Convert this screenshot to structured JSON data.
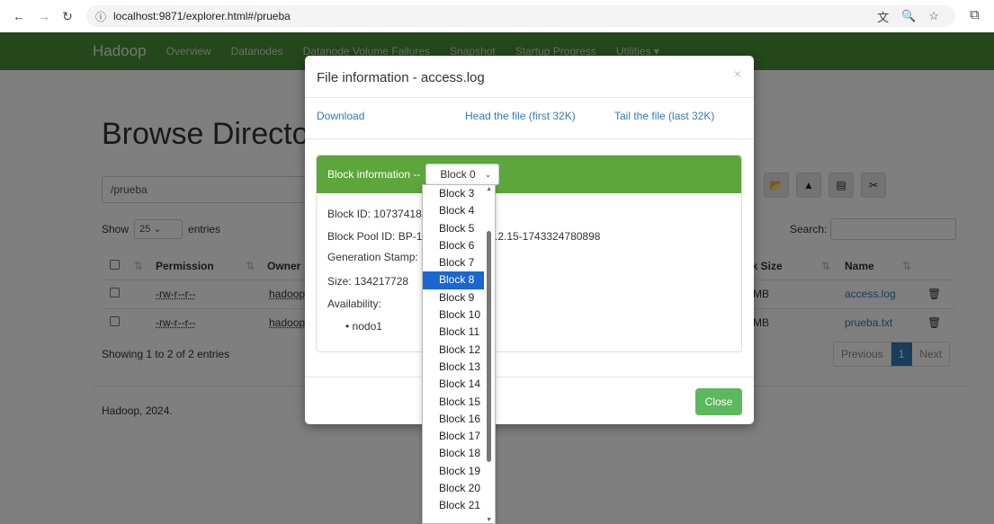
{
  "browser": {
    "url": "localhost:9871/explorer.html#/prueba",
    "icons": [
      "back-icon",
      "forward-icon",
      "reload-icon",
      "info-icon",
      "translate-icon",
      "zoom-icon",
      "star-icon",
      "extensions-icon"
    ]
  },
  "navbar": {
    "brand": "Hadoop",
    "links": [
      "Overview",
      "Datanodes",
      "Datanode Volume Failures",
      "Snapshot",
      "Startup Progress",
      "Utilities ▾"
    ]
  },
  "page": {
    "heading": "Browse Directory",
    "path": "/prueba",
    "show_label": "Show",
    "show_value": "25",
    "entries_label": "entries",
    "search_label": "Search:",
    "columns": [
      "Permission",
      "Owner",
      "ck Size",
      "Name"
    ],
    "rows": [
      {
        "permission": "-rw-r--r--",
        "owner": "hadoop",
        "block_size": "MB",
        "name": "access.log"
      },
      {
        "permission": "-rw-r--r--",
        "owner": "hadoop",
        "block_size": "MB",
        "name": "prueba.txt"
      }
    ],
    "showing": "Showing 1 to 2 of 2 entries",
    "pager": {
      "previous": "Previous",
      "current": "1",
      "next": "Next"
    },
    "footer": "Hadoop, 2024."
  },
  "modal": {
    "title": "File information - access.log",
    "close_x": "×",
    "links": {
      "download": "Download",
      "head": "Head the file (first 32K)",
      "tail": "Tail the file (last 32K)"
    },
    "block_info_label": "Block information --",
    "block_selected": "Block 0",
    "block_id": "Block ID: 107374182",
    "block_pool_id": "Block Pool ID: BP-1",
    "block_pool_suffix": ".2.15-1743324780898",
    "generation_stamp": "Generation Stamp: ",
    "size": "Size: 134217728",
    "availability": "Availability:",
    "node": "nodo1",
    "close_button": "Close"
  },
  "dropdown": {
    "options": [
      "Block 3",
      "Block 4",
      "Block 5",
      "Block 6",
      "Block 7",
      "Block 8",
      "Block 9",
      "Block 10",
      "Block 11",
      "Block 12",
      "Block 13",
      "Block 14",
      "Block 15",
      "Block 16",
      "Block 17",
      "Block 18",
      "Block 19",
      "Block 20",
      "Block 21"
    ],
    "highlighted": "Block 8"
  }
}
